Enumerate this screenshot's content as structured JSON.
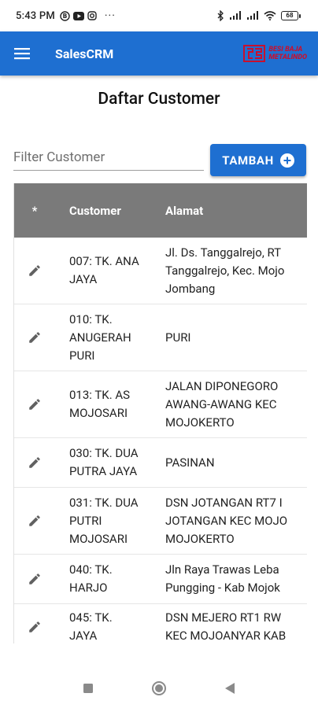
{
  "status_bar": {
    "time": "5:43 PM",
    "left_icons": [
      "b-circle-icon",
      "youtube-icon",
      "instagram-icon"
    ],
    "more": "···",
    "battery": "68"
  },
  "app_bar": {
    "title": "SalesCRM",
    "logo_line1": "BESI BAJA",
    "logo_line2": "METALINDO",
    "colors": {
      "primary": "#1e6fd1",
      "logo_red": "#c8102e"
    }
  },
  "page": {
    "title": "Daftar Customer",
    "filter_placeholder": "Filter Customer",
    "add_button_label": "TAMBAH"
  },
  "table": {
    "headers": {
      "star": "*",
      "customer": "Customer",
      "address": "Alamat"
    },
    "rows": [
      {
        "customer": [
          "007: TK. ANA",
          "JAYA"
        ],
        "address": [
          "Jl. Ds. Tanggalrejo, RT",
          "Tanggalrejo, Kec. Mojo",
          "Jombang"
        ]
      },
      {
        "customer": [
          "010: TK.",
          "ANUGERAH",
          "PURI"
        ],
        "address": [
          "PURI"
        ]
      },
      {
        "customer": [
          "013: TK. AS",
          "MOJOSARI"
        ],
        "address": [
          "JALAN DIPONEGORO",
          "AWANG-AWANG KEC",
          "MOJOKERTO"
        ]
      },
      {
        "customer": [
          "030: TK. DUA",
          "PUTRA JAYA"
        ],
        "address": [
          "PASINAN"
        ]
      },
      {
        "customer": [
          "031: TK. DUA",
          "PUTRI",
          "MOJOSARI"
        ],
        "address": [
          "DSN JOTANGAN RT7 I",
          "JOTANGAN KEC MOJO",
          "MOJOKERTO"
        ]
      },
      {
        "customer": [
          "040: TK.",
          "HARJO"
        ],
        "address": [
          "Jln Raya Trawas Leba",
          "Pungging - Kab Mojok"
        ]
      },
      {
        "customer": [
          "045: TK.",
          "JAYA"
        ],
        "address": [
          "DSN MEJERO RT1 RW",
          "KEC MOJOANYAR KAB"
        ]
      }
    ]
  },
  "nav_bar": {
    "icons": [
      "square-icon",
      "circle-icon",
      "back-triangle-icon"
    ]
  }
}
